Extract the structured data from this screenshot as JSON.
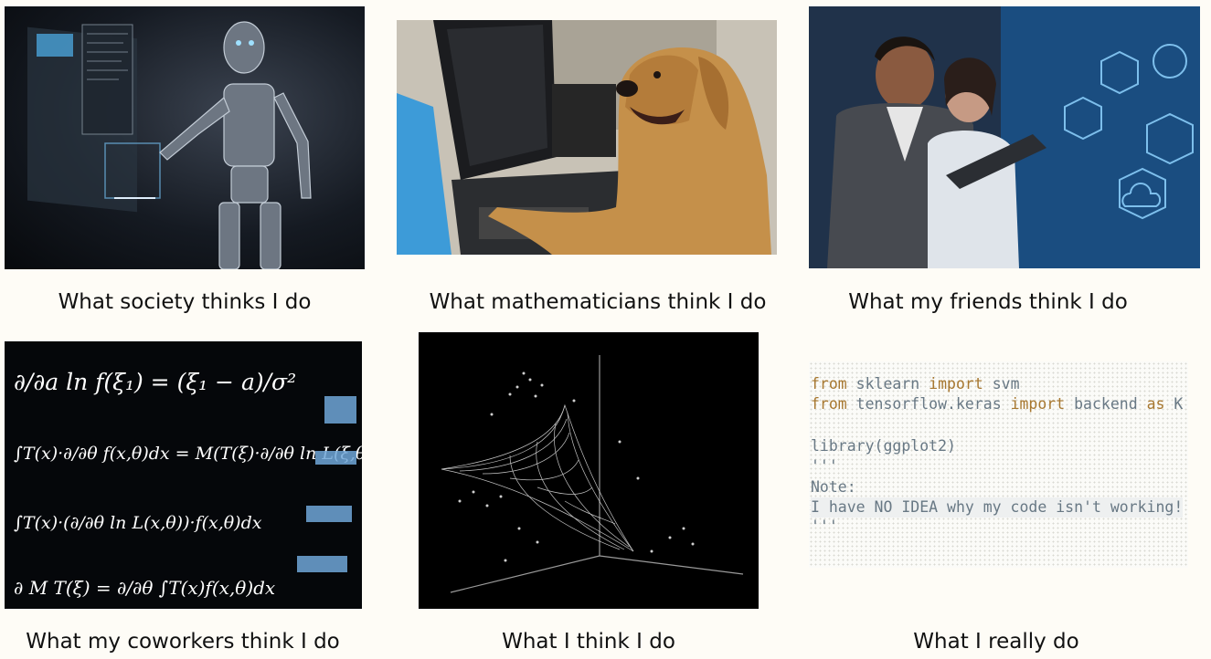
{
  "captions": [
    "What society thinks I do",
    "What mathematicians think I do",
    "What my friends think I do",
    "What my coworkers think I do",
    "What I think I do",
    "What I really do"
  ],
  "code": {
    "line1": {
      "kw1": "from",
      "mod": " sklearn ",
      "kw2": "import",
      "rest": " svm"
    },
    "line2": {
      "kw1": "from",
      "mod": " tensorflow.keras ",
      "kw2": "import",
      "mid": " backend ",
      "kw3": "as",
      "rest": " K"
    },
    "line3": "library(ggplot2)",
    "line4": "'''",
    "line5": "Note:",
    "line6": "I have NO IDEA why my code isn't working!",
    "line7": "'''"
  },
  "equations": {
    "e1": "∂/∂a ln f(ξ₁) = (ξ₁ − a)/σ²",
    "e2": "∫T(x)·∂/∂θ f(x,θ)dx = M(T(ξ)·∂/∂θ ln L(ξ,θ))",
    "e3": "∫T(x)·(∂/∂θ ln L(x,θ))·f(x,θ)dx",
    "e4": "∂ M T(ξ) = ∂/∂θ ∫T(x)f(x,θ)dx"
  },
  "colors": {
    "background": "#fefcf6",
    "code_text": "#687884",
    "code_keyword": "#a7772f",
    "equation_highlight": "#6fa6d8"
  }
}
